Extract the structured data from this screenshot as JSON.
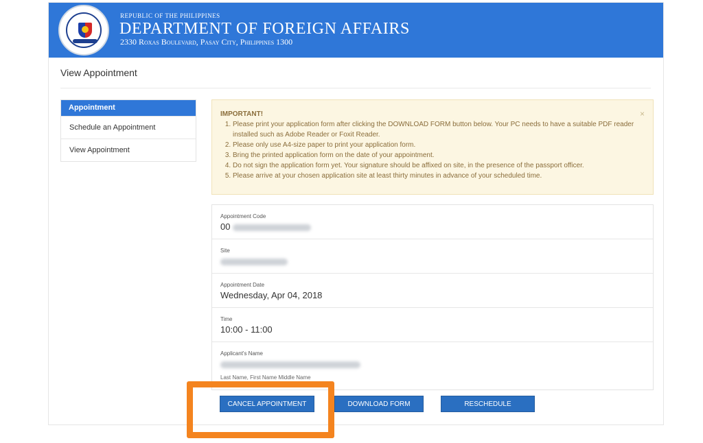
{
  "header": {
    "republic": "REPUBLIC OF THE PHILIPPINES",
    "department": "DEPARTMENT OF FOREIGN AFFAIRS",
    "address": "2330 Roxas Boulevard, Pasay City, Philippines 1300",
    "banner_color": "#2f77d8"
  },
  "page_title": "View Appointment",
  "sidebar": {
    "header": "Appointment",
    "items": [
      {
        "label": "Schedule an Appointment"
      },
      {
        "label": "View Appointment"
      }
    ]
  },
  "notice": {
    "title": "IMPORTANT!",
    "close": "×",
    "items": [
      "Please print your application form after clicking the DOWNLOAD FORM button below. Your PC needs to have a suitable PDF reader installed such as Adobe Reader or Foxit Reader.",
      "Please only use A4-size paper to print your application form.",
      "Bring the printed application form on the date of your appointment.",
      "Do not sign the application form yet. Your signature should be affixed on site, in the presence of the passport officer.",
      "Please arrive at your chosen application site at least thirty minutes in advance of your scheduled time."
    ]
  },
  "details": {
    "code_label": "Appointment Code",
    "code_value": "00",
    "site_label": "Site",
    "date_label": "Appointment Date",
    "date_value": "Wednesday, Apr 04, 2018",
    "time_label": "Time",
    "time_value": "10:00 - 11:00",
    "name_label": "Applicant's Name",
    "name_hint": "Last Name, First Name Middle Name"
  },
  "buttons": {
    "cancel": "CANCEL APPOINTMENT",
    "download": "DOWNLOAD FORM",
    "reschedule": "RESCHEDULE",
    "button_color": "#2a6fc1",
    "highlight_color": "#f4841f"
  }
}
